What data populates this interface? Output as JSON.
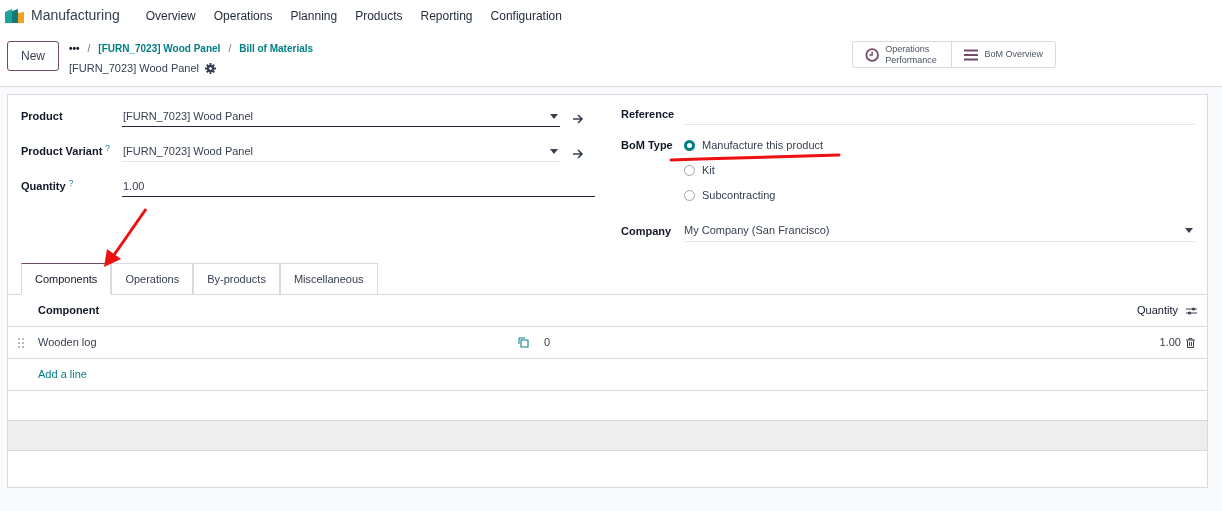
{
  "app": {
    "name": "Manufacturing"
  },
  "menu": [
    "Overview",
    "Operations",
    "Planning",
    "Products",
    "Reporting",
    "Configuration"
  ],
  "control_panel": {
    "new_button": "New",
    "more": "•••",
    "separator": "/",
    "breadcrumbs": [
      "[FURN_7023] Wood Panel",
      "Bill of Materials"
    ],
    "record_title": "[FURN_7023] Wood Panel",
    "buttons": [
      {
        "kind": "clock",
        "label": "Operations Performance"
      },
      {
        "kind": "bars",
        "label": "BoM Overview"
      }
    ]
  },
  "form": {
    "left": [
      {
        "label": "Product",
        "value": "[FURN_7023] Wood Panel",
        "kind": "many2one",
        "required": true
      },
      {
        "label": "Product Variant",
        "help": "?",
        "value": "[FURN_7023] Wood Panel",
        "kind": "many2one",
        "required": false
      },
      {
        "label": "Quantity",
        "help": "?",
        "value": "1.00",
        "kind": "text",
        "required": true
      }
    ],
    "reference": {
      "label": "Reference"
    },
    "bom_type": {
      "label": "BoM Type",
      "options": [
        {
          "label": "Manufacture this product",
          "selected": true
        },
        {
          "label": "Kit",
          "selected": false
        },
        {
          "label": "Subcontracting",
          "selected": false
        }
      ]
    },
    "company": {
      "label": "Company",
      "value": "My Company (San Francisco)"
    }
  },
  "tabs": [
    {
      "label": "Components",
      "selected": true
    },
    {
      "label": "Operations",
      "selected": false
    },
    {
      "label": "By-products",
      "selected": false
    },
    {
      "label": "Miscellaneous",
      "selected": false
    }
  ],
  "table": {
    "columns": [
      "Component",
      "Quantity"
    ],
    "rows": [
      {
        "component": "Wooden log",
        "forecast": "0",
        "quantity": "1.00"
      }
    ],
    "add_line": "Add a line"
  }
}
